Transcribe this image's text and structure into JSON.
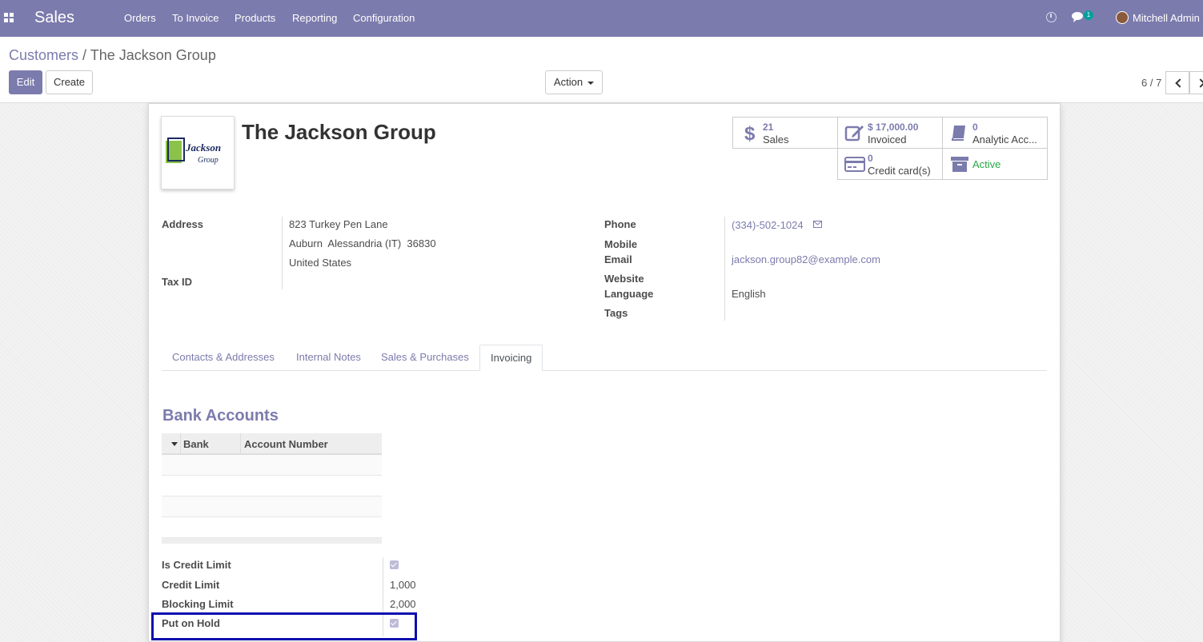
{
  "nav": {
    "app_name": "Sales",
    "menu": [
      "Orders",
      "To Invoice",
      "Products",
      "Reporting",
      "Configuration"
    ],
    "chat_badge": "1",
    "user_name": "Mitchell Admin",
    "icons": [
      "apps-grid-icon",
      "clock-icon",
      "chat-icon",
      "avatar"
    ]
  },
  "breadcrumb": {
    "parent": "Customers",
    "separator": "/",
    "current": "The Jackson Group"
  },
  "toolbar": {
    "edit_label": "Edit",
    "create_label": "Create",
    "action_label": "Action"
  },
  "pager": {
    "value": "6 / 7"
  },
  "partner": {
    "name": "The Jackson Group",
    "logo_text": [
      "Jackson",
      "Group"
    ]
  },
  "stats": {
    "sales": {
      "value": "21",
      "label": "Sales"
    },
    "invoiced": {
      "value": "$ 17,000.00",
      "label": "Invoiced"
    },
    "analytic": {
      "value": "0",
      "label": "Analytic Acc..."
    },
    "credit_cards": {
      "value": "0",
      "label": "Credit card(s)"
    },
    "active": {
      "label": "Active"
    }
  },
  "form_left": {
    "address_label": "Address",
    "street": "823 Turkey Pen Lane",
    "city_line": "Auburn  Alessandria (IT)  36830",
    "country": "United States",
    "tax_id_label": "Tax ID"
  },
  "form_right": {
    "phone_label": "Phone",
    "phone_value": "(334)-502-1024",
    "mobile_label": "Mobile",
    "email_label": "Email",
    "email_value": "jackson.group82@example.com",
    "website_label": "Website",
    "language_label": "Language",
    "language_value": "English",
    "tags_label": "Tags"
  },
  "tabs": [
    "Contacts & Addresses",
    "Internal Notes",
    "Sales & Purchases",
    "Invoicing"
  ],
  "active_tab": "Invoicing",
  "bank": {
    "title": "Bank Accounts",
    "columns": [
      "Bank",
      "Account Number"
    ]
  },
  "credit": {
    "is_credit_limit_label": "Is Credit Limit",
    "is_credit_limit": true,
    "credit_limit_label": "Credit Limit",
    "credit_limit_value": "1,000",
    "blocking_limit_label": "Blocking Limit",
    "blocking_limit_value": "2,000",
    "put_on_hold_label": "Put on Hold",
    "put_on_hold": true
  },
  "colors": {
    "brand": "#7c7bad",
    "active": "#28a745",
    "highlight": "#0d0daf"
  }
}
